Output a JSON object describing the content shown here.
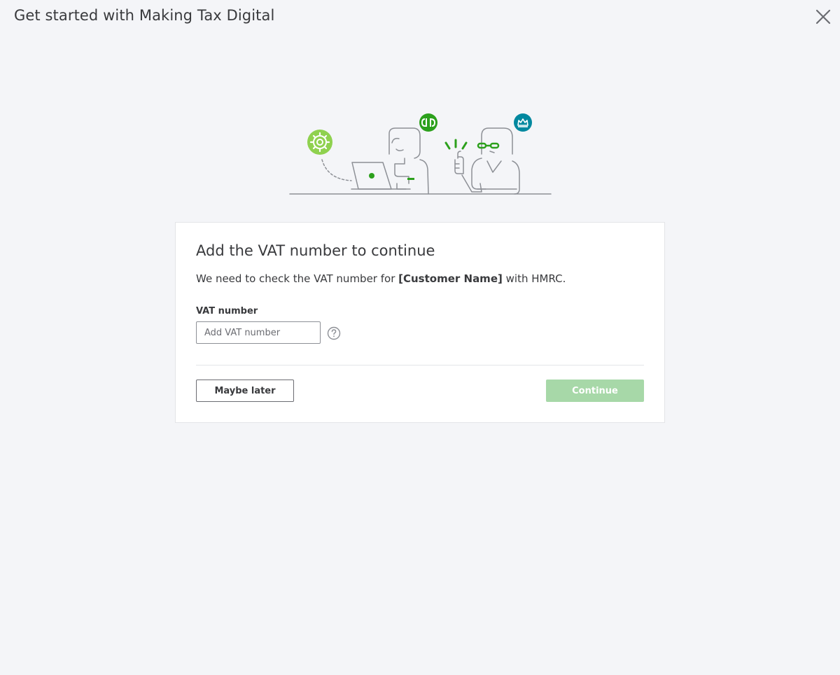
{
  "header": {
    "title": "Get started with Making Tax Digital",
    "close_icon": "close-icon"
  },
  "card": {
    "heading": "Add the VAT number to continue",
    "description_prefix": "We need to check the VAT number for ",
    "description_bold": "[Customer Name]",
    "description_suffix": " with HMRC.",
    "vat_field": {
      "label": "VAT number",
      "value": "",
      "placeholder": "Add VAT number",
      "help_icon": "help-icon"
    },
    "buttons": {
      "maybe_later": "Maybe later",
      "continue": "Continue"
    }
  },
  "colors": {
    "background": "#f4f5f8",
    "brand_green": "#2ca01c",
    "light_green": "#8fd14f",
    "hmrc_teal": "#00889f",
    "continue_disabled": "#a7d8a8"
  }
}
